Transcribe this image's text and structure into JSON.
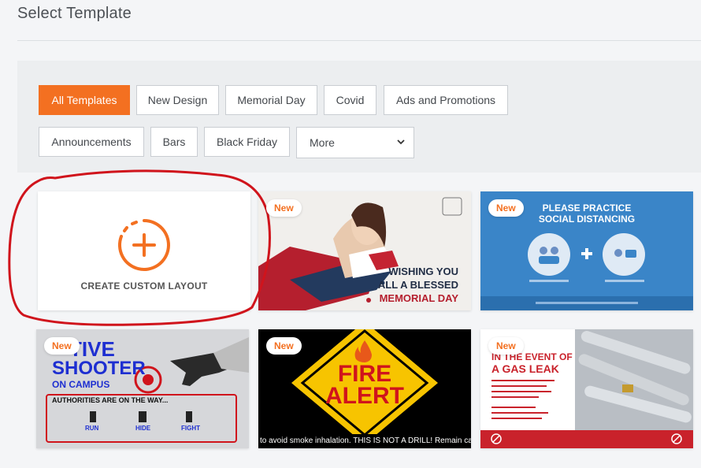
{
  "page": {
    "title": "Select Template"
  },
  "filters": {
    "chips": [
      {
        "label": "All Templates",
        "active": true
      },
      {
        "label": "New Design"
      },
      {
        "label": "Memorial Day"
      },
      {
        "label": "Covid"
      },
      {
        "label": "Ads and Promotions"
      },
      {
        "label": "Announcements"
      },
      {
        "label": "Bars"
      },
      {
        "label": "Black Friday"
      }
    ],
    "more": {
      "value": "More"
    }
  },
  "badge_label": "New",
  "cards": {
    "custom": {
      "label": "CREATE CUSTOM LAYOUT"
    },
    "memorial": {
      "line1": "WISHING YOU",
      "line2": "ALL A BLESSED",
      "line3": "MEMORIAL DAY"
    },
    "distancing": {
      "line1": "PLEASE PRACTICE",
      "line2": "SOCIAL DISTANCING"
    },
    "shooter": {
      "line1": "TIVE",
      "line2": "SHOOTER",
      "line3": "ON CAMPUS",
      "line4": "AUTHORITIES  ARE ON THE WAY...",
      "run": "RUN",
      "hide": "HIDE",
      "fight": "FIGHT"
    },
    "fire": {
      "line1": "FIRE",
      "line2": "ALERT",
      "ticker": "to avoid smoke inhalation. THIS IS NOT A DRILL! Remain calm an"
    },
    "gas": {
      "line1": "IN THE EVENT OF",
      "line2": "A GAS LEAK"
    }
  },
  "colors": {
    "accent": "#f37021",
    "annotation": "#d0141c"
  }
}
